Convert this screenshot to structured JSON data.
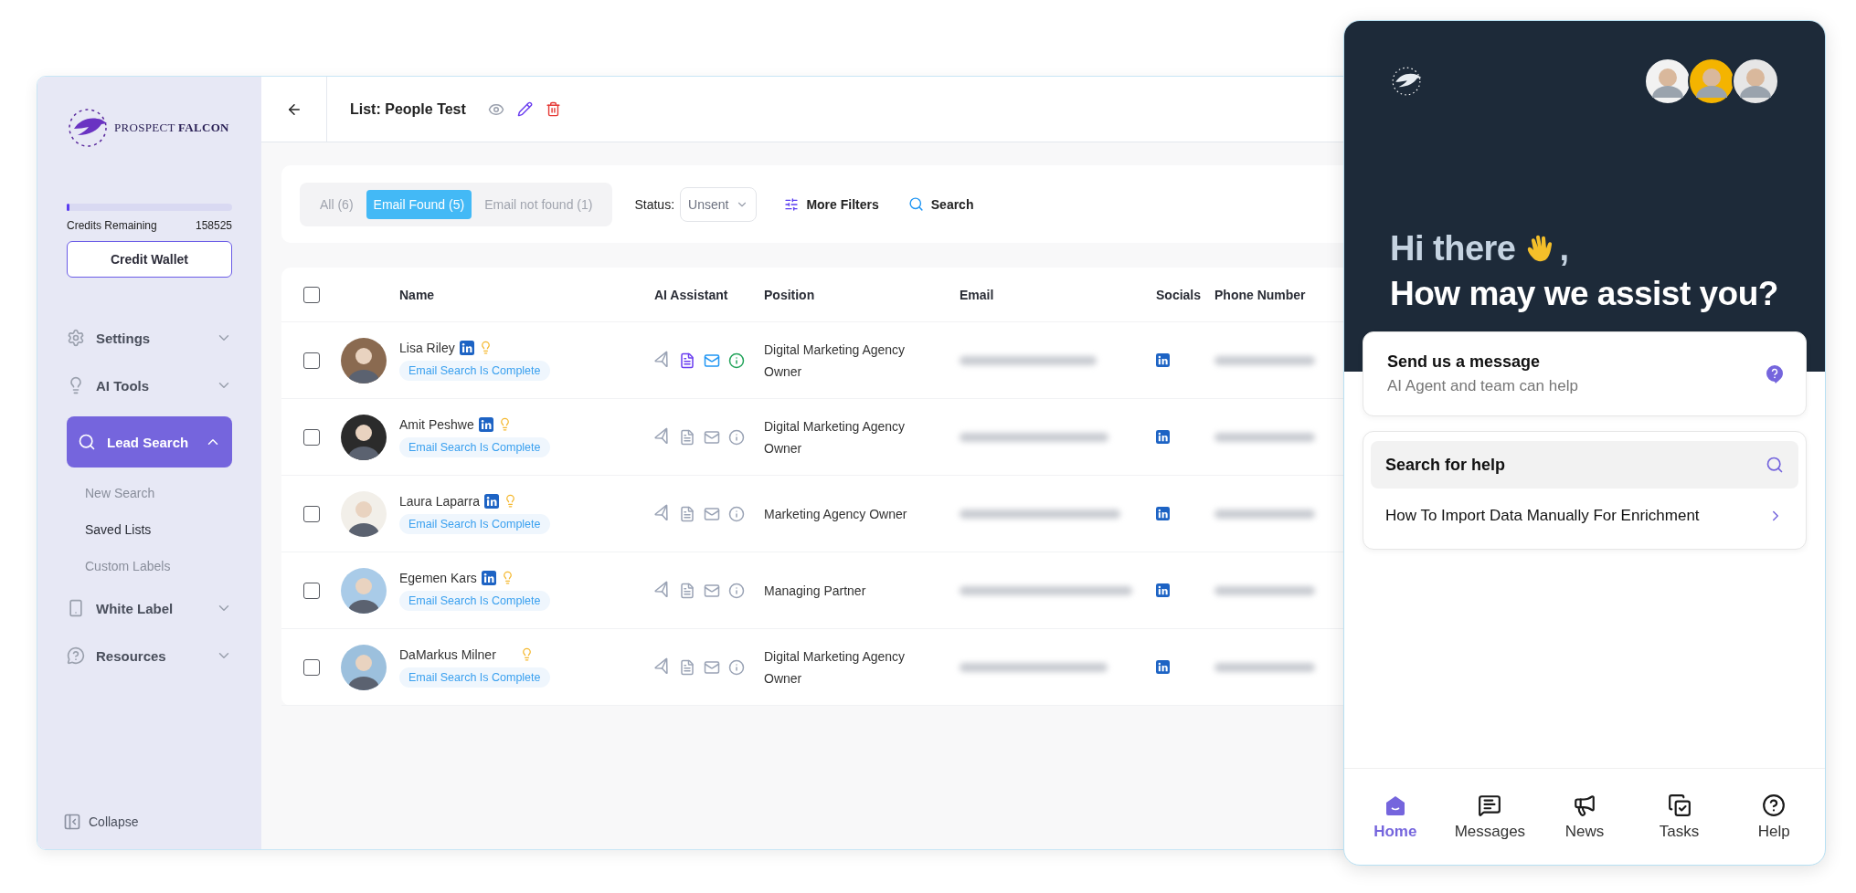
{
  "sidebar": {
    "brand": {
      "word1": "PROSPECT",
      "word2": "FALCON"
    },
    "credits": {
      "label": "Credits Remaining",
      "value": "158525",
      "level": 0.01
    },
    "wallet_button": "Credit Wallet",
    "nav": [
      {
        "label": "Settings",
        "selected": false,
        "expanded": false
      },
      {
        "label": "AI Tools",
        "selected": false,
        "expanded": false
      },
      {
        "label": "Lead Search",
        "selected": true,
        "expanded": true,
        "children": [
          {
            "label": "New Search",
            "selected": false
          },
          {
            "label": "Saved Lists",
            "selected": true
          },
          {
            "label": "Custom Labels",
            "selected": false
          }
        ]
      },
      {
        "label": "White Label",
        "selected": false,
        "expanded": false
      },
      {
        "label": "Resources",
        "selected": false,
        "expanded": false
      }
    ],
    "collapse": "Collapse"
  },
  "header": {
    "title": "List: People Test"
  },
  "filters": {
    "tabs": [
      {
        "label": "All (6)",
        "selected": false
      },
      {
        "label": "Email Found (5)",
        "selected": true
      },
      {
        "label": "Email not found (1)",
        "selected": false
      }
    ],
    "status_label": "Status:",
    "status_value": "Unsent",
    "more_filters": "More Filters",
    "search": "Search"
  },
  "table": {
    "all_checked": false,
    "columns": [
      "Name",
      "AI Assistant",
      "Position",
      "Email",
      "Socials",
      "Phone Number"
    ],
    "rows": [
      {
        "checked": false,
        "name": "Lisa Riley",
        "linkedin": true,
        "status": "Email Search Is Complete",
        "ai_active": true,
        "position": "Digital Marketing Agency Owner",
        "social_linkedin": true
      },
      {
        "checked": false,
        "name": "Amit Peshwe",
        "linkedin": true,
        "status": "Email Search Is Complete",
        "ai_active": false,
        "position": "Digital Marketing Agency Owner",
        "social_linkedin": true
      },
      {
        "checked": false,
        "name": "Laura Laparra",
        "linkedin": true,
        "status": "Email Search Is Complete",
        "ai_active": false,
        "position": "Marketing Agency Owner",
        "social_linkedin": true
      },
      {
        "checked": false,
        "name": "Egemen Kars",
        "linkedin": true,
        "status": "Email Search Is Complete",
        "ai_active": false,
        "position": "Managing Partner",
        "social_linkedin": true
      },
      {
        "checked": false,
        "name": "DaMarkus Milner",
        "linkedin": false,
        "status": "Email Search Is Complete",
        "ai_active": false,
        "position": "Digital Marketing Agency Owner",
        "social_linkedin": true
      }
    ]
  },
  "chat_widget": {
    "greeting": {
      "text": "Hi there",
      "end": ","
    },
    "headline": "How may we assist you?",
    "message_card": {
      "title": "Send us a message",
      "subtitle": "AI Agent and team can help"
    },
    "help_search": {
      "placeholder": "Search for help"
    },
    "articles": [
      "How To Import Data Manually For Enrichment"
    ],
    "nav": [
      {
        "label": "Home",
        "selected": true
      },
      {
        "label": "Messages",
        "selected": false
      },
      {
        "label": "News",
        "selected": false
      },
      {
        "label": "Tasks",
        "selected": false
      },
      {
        "label": "Help",
        "selected": false
      }
    ]
  }
}
